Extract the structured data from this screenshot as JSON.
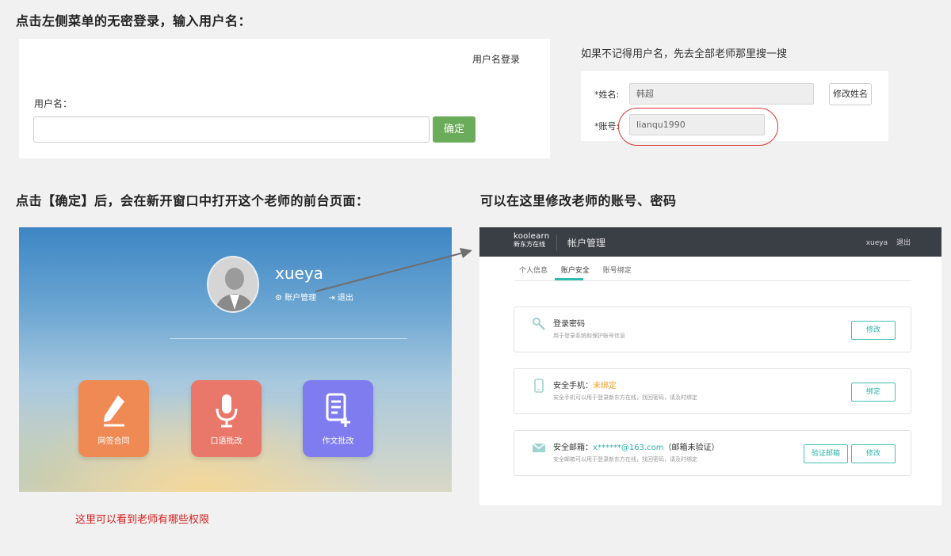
{
  "headings": {
    "h1": "点击左侧菜单的无密登录，输入用户名：",
    "h2": "如果不记得用户名，先去全部老师那里搜一搜",
    "h3": "点击【确定】后，会在新开窗口中打开这个老师的前台页面：",
    "h4": "可以在这里修改老师的账号、密码"
  },
  "login": {
    "tab": "用户名登录",
    "label": "用户名：",
    "value": "",
    "button": "确定"
  },
  "search": {
    "name_label": "*姓名:",
    "name_value": "韩超",
    "account_label": "*账号:",
    "account_value": "lianqu1990",
    "edit_button": "修改姓名"
  },
  "teacher": {
    "username": "xueya",
    "account_link": "账户管理",
    "logout_link": "退出",
    "tiles": [
      "网签合同",
      "口语批改",
      "作文批改"
    ]
  },
  "note": "这里可以看到老师有哪些权限",
  "account": {
    "brand_line1": "koolearn",
    "brand_line2": "新东方在线",
    "title": "帐户管理",
    "user": "xueya",
    "logout": "退出",
    "tabs": [
      "个人信息",
      "账户安全",
      "账号绑定"
    ],
    "cards": [
      {
        "title": "登录密码",
        "status": "",
        "desc": "用于登录系统和保护账号信息",
        "buttons": [
          "修改"
        ]
      },
      {
        "title": "安全手机：",
        "status": "未绑定",
        "desc": "安全手机可以用于登录新东方在线，找回密码，请及时绑定",
        "buttons": [
          "绑定"
        ]
      },
      {
        "title": "安全邮箱：",
        "status": "x******@163.com",
        "extra": "（邮箱未验证）",
        "desc": "安全邮箱可以用于登录新东方在线，找回密码，请及时绑定",
        "buttons": [
          "验证邮箱",
          "修改"
        ]
      }
    ]
  },
  "colors": {
    "confirm_button": "#6aac5a",
    "highlight_ring": "#d9372b",
    "tile_contract": "#f08a55",
    "tile_speaking": "#e9786a",
    "tile_writing": "#7f7cf0",
    "accent_teal": "#2bb3ac",
    "status_orange": "#f2a12e",
    "note_red": "#d61f1f"
  }
}
